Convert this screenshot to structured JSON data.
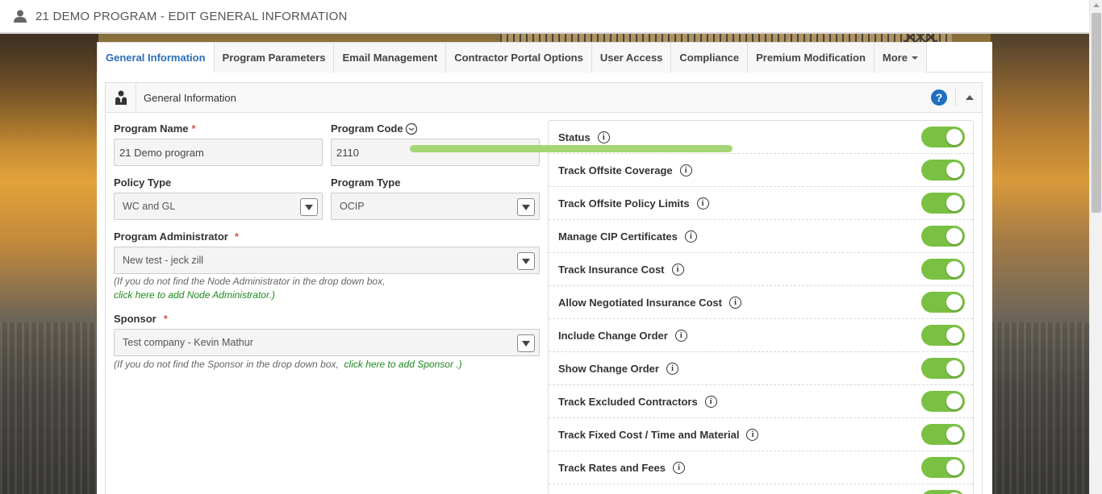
{
  "header": {
    "title": "21 DEMO PROGRAM - EDIT GENERAL INFORMATION"
  },
  "tabs": [
    {
      "label": "General Information",
      "active": true
    },
    {
      "label": "Program Parameters"
    },
    {
      "label": "Email Management"
    },
    {
      "label": "Contractor Portal Options"
    },
    {
      "label": "User Access"
    },
    {
      "label": "Compliance"
    },
    {
      "label": "Premium Modification"
    },
    {
      "label": "More"
    }
  ],
  "section": {
    "title": "General Information",
    "help": "?"
  },
  "form": {
    "program_name": {
      "label": "Program Name",
      "required": "*",
      "value": "21 Demo program"
    },
    "program_code": {
      "label": "Program Code",
      "value": "2110"
    },
    "policy_type": {
      "label": "Policy Type",
      "value": "WC and GL"
    },
    "program_type": {
      "label": "Program Type",
      "value": "OCIP"
    },
    "program_admin": {
      "label": "Program Administrator",
      "required": "*",
      "value": "New test - jeck zill",
      "hint": "(If you do not find the Node Administrator in the drop down box,",
      "hint_link": "click here to add Node Administrator.)"
    },
    "sponsor": {
      "label": "Sponsor",
      "required": "*",
      "value": "Test company - Kevin Mathur",
      "hint": "(If you do not find the Sponsor in the drop down box,",
      "hint_link": "click here to add Sponsor .)"
    }
  },
  "toggles": [
    {
      "label": "Status",
      "on": true
    },
    {
      "label": "Track Offsite Coverage",
      "on": true
    },
    {
      "label": "Track Offsite Policy Limits",
      "on": true
    },
    {
      "label": "Manage CIP Certificates",
      "on": true
    },
    {
      "label": "Track Insurance Cost",
      "on": true
    },
    {
      "label": "Allow Negotiated Insurance Cost",
      "on": true
    },
    {
      "label": "Include Change Order",
      "on": true
    },
    {
      "label": "Show Change Order",
      "on": true
    },
    {
      "label": "Track Excluded Contractors",
      "on": true
    },
    {
      "label": "Track Fixed Cost / Time and Material",
      "on": true
    },
    {
      "label": "Track Rates and Fees",
      "on": true
    },
    {
      "label": "",
      "on": true
    }
  ],
  "colors": {
    "accent": "#2a6ebb",
    "toggle_on": "#7ac143",
    "link": "#1d8a1d",
    "required": "#d9534f"
  }
}
